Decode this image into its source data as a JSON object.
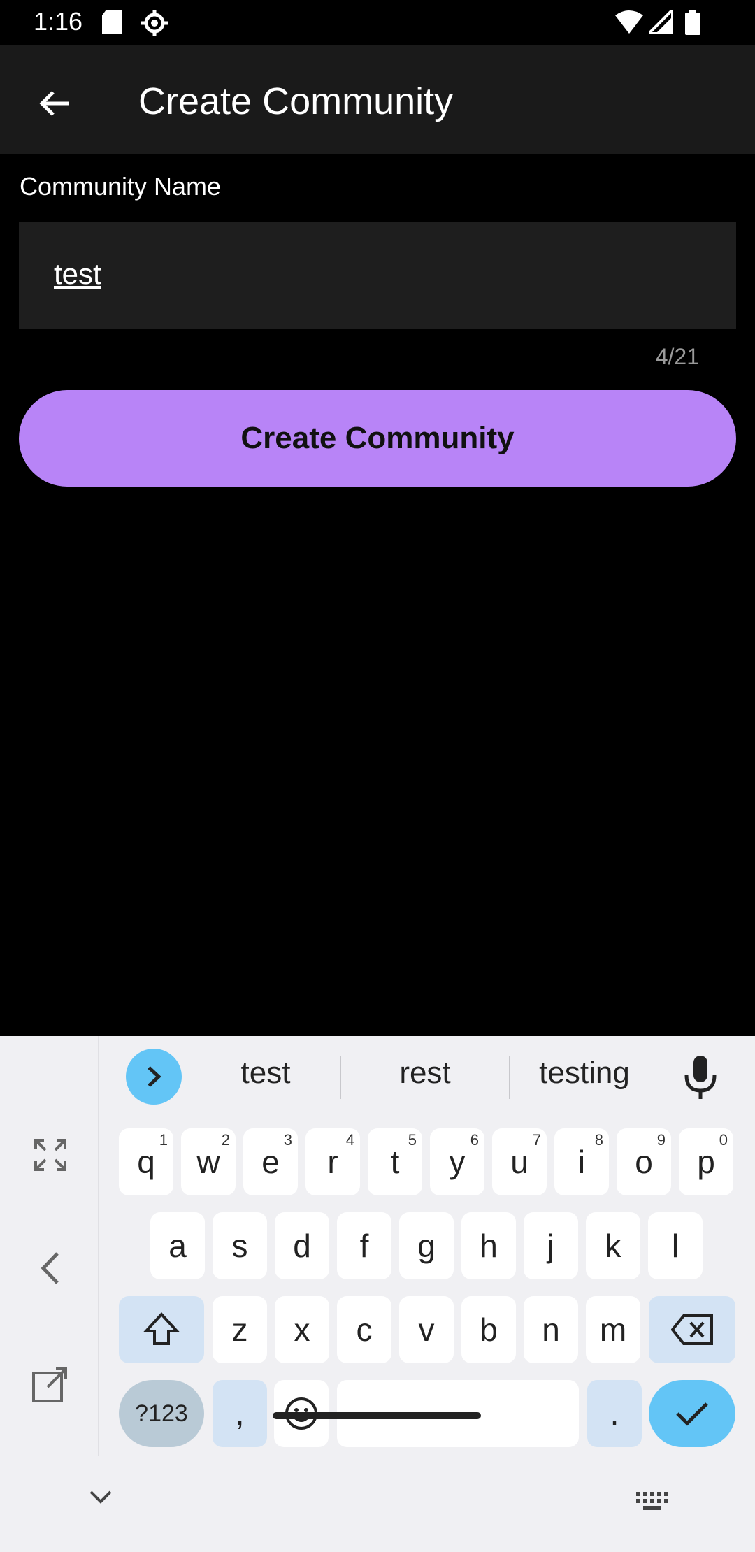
{
  "status_bar": {
    "time": "1:16"
  },
  "app_bar": {
    "title": "Create Community"
  },
  "form": {
    "label": "Community Name",
    "value": "test",
    "counter": "4/21",
    "submit_label": "Create Community"
  },
  "keyboard": {
    "suggestions": [
      "test",
      "rest",
      "testing"
    ],
    "row1": [
      {
        "key": "q",
        "hint": "1"
      },
      {
        "key": "w",
        "hint": "2"
      },
      {
        "key": "e",
        "hint": "3"
      },
      {
        "key": "r",
        "hint": "4"
      },
      {
        "key": "t",
        "hint": "5"
      },
      {
        "key": "y",
        "hint": "6"
      },
      {
        "key": "u",
        "hint": "7"
      },
      {
        "key": "i",
        "hint": "8"
      },
      {
        "key": "o",
        "hint": "9"
      },
      {
        "key": "p",
        "hint": "0"
      }
    ],
    "row2": [
      "a",
      "s",
      "d",
      "f",
      "g",
      "h",
      "j",
      "k",
      "l"
    ],
    "row3": [
      "z",
      "x",
      "c",
      "v",
      "b",
      "n",
      "m"
    ],
    "symbols_label": "?123",
    "comma_label": ",",
    "period_label": "."
  }
}
